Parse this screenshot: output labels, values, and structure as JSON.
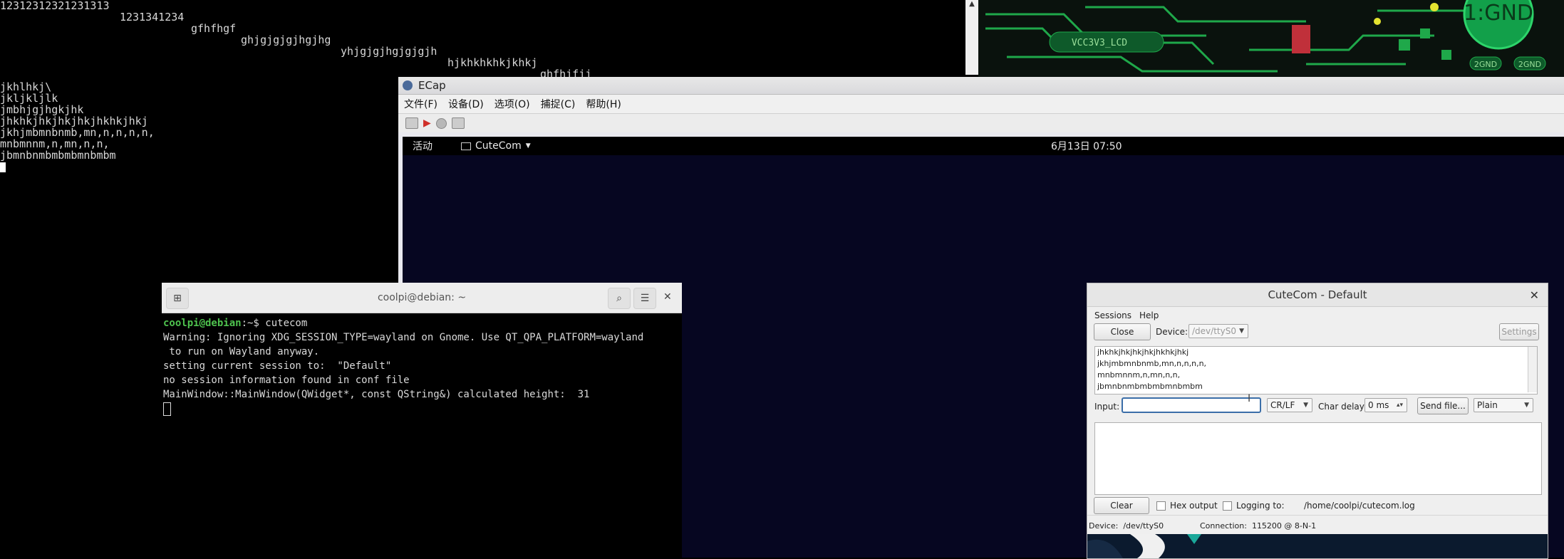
{
  "left_terminal": {
    "lines_top": [
      {
        "text": "12312312321231313",
        "indent": 0
      },
      {
        "text": "1231341234",
        "indent": 1
      },
      {
        "text": "gfhfhgf",
        "indent": 2
      },
      {
        "text": "ghjgjgjgjhgjhg",
        "indent": 3
      },
      {
        "text": "yhjgjgjhgjgjgjh",
        "indent": 4
      },
      {
        "text": "hjkhkhkhkjkhkj",
        "indent": 5
      },
      {
        "text": "ghfhjfjj",
        "indent": 6
      }
    ],
    "lines_bottom": [
      "jkhlhkj\\",
      "jkljkljlk",
      "jmbhjgjhgkjhk",
      "jhkhkjhkjhkjhkjhkhkjhkj",
      "jkhjmbmnbnmb,mn,n,n,n,n,",
      "mnbmnnm,n,mn,n,n,",
      "jbmnbnmbmbmbmnbmbm"
    ]
  },
  "pcb": {
    "labels": [
      "VCC3V3_LCD",
      "1:GND",
      "2GND",
      "2GND"
    ]
  },
  "ecap": {
    "title": "ECap",
    "menu": [
      "文件(F)",
      "设备(D)",
      "选项(O)",
      "捕捉(C)",
      "帮助(H)"
    ],
    "toolbar_icons": [
      "camera-icon",
      "record-icon",
      "stop-icon",
      "screenshot-icon"
    ]
  },
  "gnome_topbar": {
    "activities": "活动",
    "app_name": "CuteCom",
    "datetime": "6月13日  07:50"
  },
  "gnome_terminal": {
    "title": "coolpi@debian: ~",
    "prompt_user": "coolpi@debian",
    "prompt_rest": ":~$ cutecom",
    "output": [
      "Warning: Ignoring XDG_SESSION_TYPE=wayland on Gnome. Use QT_QPA_PLATFORM=wayland",
      " to run on Wayland anyway.",
      "setting current session to:  \"Default\"",
      "no session information found in conf file",
      "MainWindow::MainWindow(QWidget*, const QString&) calculated height:  31"
    ]
  },
  "cutecom": {
    "title": "CuteCom - Default",
    "menu": [
      "Sessions",
      "Help"
    ],
    "close_button": "Close",
    "device_label": "Device:",
    "device_value": "/dev/ttyS0",
    "settings_button": "Settings",
    "output_lines": [
      "jhkhkjhkjhkjhkjhkhkjhkj",
      "jkhjmbmnbnmb,mn,n,n,n,n,",
      "mnbmnnm,n,mn,n,n,",
      "jbmnbnmbmbmbmnbmbm"
    ],
    "input_label": "Input:",
    "input_value": "",
    "line_end": "CR/LF",
    "char_delay_label": "Char delay:",
    "char_delay_value": "0 ms",
    "send_file_button": "Send file...",
    "format": "Plain",
    "clear_button": "Clear",
    "hex_output_label": "Hex output",
    "logging_label": "Logging to:",
    "log_path": "/home/coolpi/cutecom.log",
    "status_device": "Device:  /dev/ttyS0",
    "status_connection": "Connection:  115200 @ 8-N-1"
  },
  "colors": {
    "terminal_bg": "#000000",
    "desktop_bg": "#060621",
    "prompt_green": "#4ec24e",
    "pcb_green": "#1fa84a"
  }
}
